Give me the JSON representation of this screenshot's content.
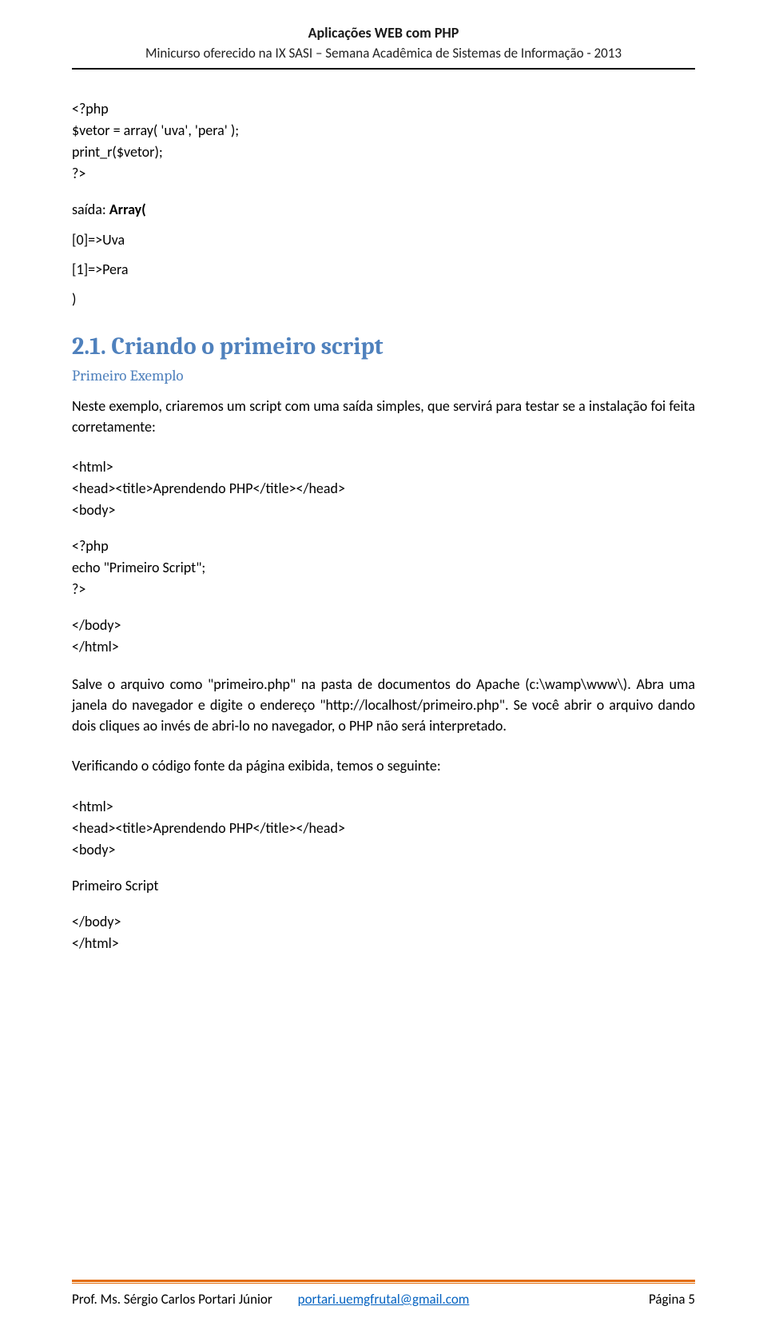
{
  "header": {
    "title": "Aplicações WEB com PHP",
    "subtitle": "Minicurso oferecido na IX SASI – Semana Acadêmica de Sistemas de Informação - 2013"
  },
  "code1": {
    "l1": "<?php",
    "l2": "$vetor = array( 'uva', 'pera' );",
    "l3": "print_r($vetor);",
    "l4": "?>"
  },
  "output": {
    "label_prefix": "saída: ",
    "label_bold": "Array(",
    "line1": "[0]=>Uva",
    "line2": "[1]=>Pera",
    "line3": ")"
  },
  "section": {
    "heading": "2.1. Criando o primeiro script",
    "subhead": "Primeiro Exemplo",
    "intro": "Neste exemplo, criaremos um script com uma saída simples, que servirá para testar se a instalação foi feita corretamente:"
  },
  "code2": {
    "l1": "<html>",
    "l2": "<head><title>Aprendendo PHP</title></head>",
    "l3": "<body>",
    "l4": "<?php",
    "l5": "echo \"Primeiro Script\";",
    "l6": "?>",
    "l7": "</body>",
    "l8": "</html>"
  },
  "para2": "Salve o arquivo como \"primeiro.php\" na pasta de documentos do Apache (c:\\wamp\\www\\). Abra uma janela do navegador e digite o endereço \"http://localhost/primeiro.php\". Se você abrir o arquivo dando dois cliques ao invés de abri-lo no navegador, o PHP não será interpretado.",
  "para3": "Verificando o código fonte da página exibida, temos o seguinte:",
  "code3": {
    "l1": "<html>",
    "l2": "<head><title>Aprendendo PHP</title></head>",
    "l3": "<body>",
    "l4": "Primeiro Script",
    "l5": "</body>",
    "l6": "</html>"
  },
  "footer": {
    "left": "Prof. Ms. Sérgio Carlos Portari Júnior",
    "center": "portari.uemgfrutal@gmail.com",
    "right": "Página 5"
  }
}
